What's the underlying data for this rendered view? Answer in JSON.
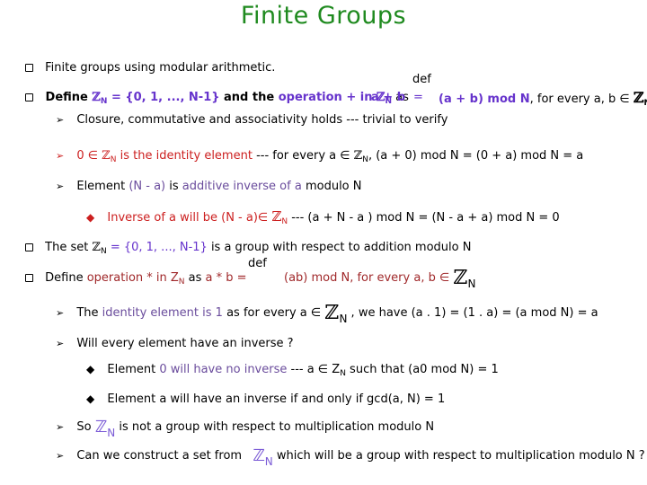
{
  "title": "Finite Groups",
  "z_symbol": "ℤ",
  "sub_n": "N",
  "items": {
    "b1": {
      "text": "Finite groups using modular arithmetic."
    },
    "b2": {
      "define": "Define ",
      "set_def": " = {0, 1, ..., N-1}",
      "and_the": " and the ",
      "operation": "operation + in ",
      "as": " as",
      "def_label": "def",
      "lhs": "a + b",
      "eq": "=",
      "rhs": "(a + b) mod N",
      "tail": ", for every a, b ∈ "
    },
    "a1": {
      "text": "Closure, commutative and associativity holds --- trivial to verify"
    },
    "a2": {
      "zero_in": "0 ∈ ",
      "identity": " is the identity element",
      "tail_a": " --- for every a ∈ ",
      "tail_b": ", (a + 0) mod N = (0 + a) mod N = a"
    },
    "a3": {
      "element": "Element ",
      "n_minus_a": "(N - a)",
      "is": " is ",
      "additive": "additive inverse of a",
      "modulo": " modulo N"
    },
    "d1": {
      "inverse": "Inverse of a will be (N - a)∈ ",
      "tail": " --- (a + N - a ) mod N = (N - a + a) mod N = 0"
    },
    "b3": {
      "the_set": "The set ",
      "set_def": " = {0, 1, ..., N-1}",
      "tail": " is a group with respect to addition modulo N"
    },
    "b4": {
      "def_label": "def",
      "define": "Define ",
      "operation": "operation *  in Z",
      "as": " as ",
      "lhs": "a *  b   =",
      "rhs": "(ab) mod N, for every a, b ∈ "
    },
    "a4": {
      "the": "The ",
      "identity": "identity element is 1",
      "as_for": " as for every a ∈ ",
      "tail": " , we have (a . 1) = (1 . a) = (a mod N) = a"
    },
    "a5": {
      "text": "Will every element have an inverse ?"
    },
    "d2": {
      "element": "Element ",
      "no_inverse": "0 will have no inverse",
      "tail_a": " ---   a ∈ Z",
      "tail_b": " such  that (a0 mod N) = 1"
    },
    "d3": {
      "text": "Element a will have an inverse if and only if gcd(a, N) = 1"
    },
    "a6": {
      "so": "So ",
      "tail": " is not a group with respect to multiplication modulo N"
    },
    "a7": {
      "lead": "Can we construct a set from ",
      "tail": " which will be a group with respect to multiplication modulo N ?"
    }
  },
  "icons": {
    "square_bullet": "☐",
    "arrow_bullet": "➢",
    "diamond_bullet": "◆"
  }
}
